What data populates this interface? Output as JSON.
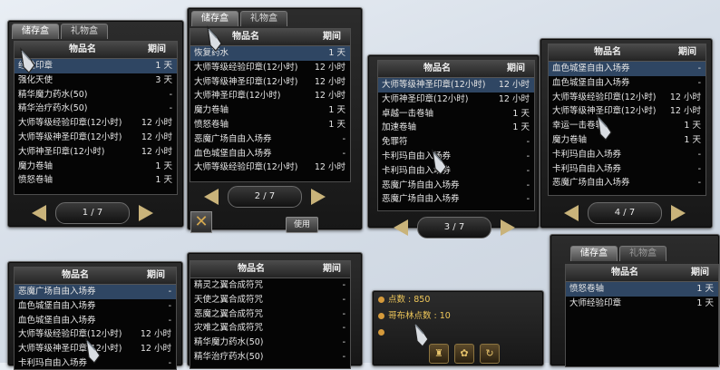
{
  "panels": [
    {
      "tabs": [
        "储存盒",
        "礼物盒"
      ],
      "header": {
        "name": "物品名",
        "period": "期间"
      },
      "page": "1 / 7",
      "items": [
        [
          "经验印章",
          "1 天"
        ],
        [
          "强化天使",
          "3 天"
        ],
        [
          "精华魔力药水(50)",
          "-"
        ],
        [
          "精华治疗药水(50)",
          "-"
        ],
        [
          "大师等级经验印章(12小时)",
          "12 小时"
        ],
        [
          "大师等级神圣印章(12小时)",
          "12 小时"
        ],
        [
          "大师神圣印章(12小时)",
          "12 小时"
        ],
        [
          "魔力卷轴",
          "1 天"
        ],
        [
          "愤怒卷轴",
          "1 天"
        ]
      ]
    },
    {
      "tabs": [
        "储存盒",
        "礼物盒"
      ],
      "header": {
        "name": "物品名",
        "period": "期间"
      },
      "page": "2 / 7",
      "use_button": "使用",
      "items": [
        [
          "恢复药水",
          "1 天"
        ],
        [
          "大师等级经验印章(12小时)",
          "12 小时"
        ],
        [
          "大师等级神圣印章(12小时)",
          "12 小时"
        ],
        [
          "大师神圣印章(12小时)",
          "12 小时"
        ],
        [
          "魔力卷轴",
          "1 天"
        ],
        [
          "愤怒卷轴",
          "1 天"
        ],
        [
          "恶魔广场自由入场券",
          "-"
        ],
        [
          "血色城堡自由入场券",
          "-"
        ],
        [
          "大师等级经验印章(12小时)",
          "12 小时"
        ]
      ]
    },
    {
      "header": {
        "name": "物品名",
        "period": "期间"
      },
      "page": "3 / 7",
      "items": [
        [
          "大师等级神圣印章(12小时)",
          "12 小时"
        ],
        [
          "大师神圣印章(12小时)",
          "12 小时"
        ],
        [
          "卓越一击卷轴",
          "1 天"
        ],
        [
          "加速卷轴",
          "1 天"
        ],
        [
          "免罪符",
          "-"
        ],
        [
          "卡利玛自由入场券",
          "-"
        ],
        [
          "卡利玛自由入场券",
          "-"
        ],
        [
          "恶魔广场自由入场券",
          "-"
        ],
        [
          "恶魔广场自由入场券",
          "-"
        ]
      ]
    },
    {
      "header": {
        "name": "物品名",
        "period": "期间"
      },
      "page": "4 / 7",
      "items": [
        [
          "血色城堡自由入场券",
          "-"
        ],
        [
          "血色城堡自由入场券",
          "-"
        ],
        [
          "大师等级经验印章(12小时)",
          "12 小时"
        ],
        [
          "大师等级神圣印章(12小时)",
          "12 小时"
        ],
        [
          "幸运一击卷轴",
          "1 天"
        ],
        [
          "魔力卷轴",
          "1 天"
        ],
        [
          "卡利玛自由入场券",
          "-"
        ],
        [
          "卡利玛自由入场券",
          "-"
        ],
        [
          "恶魔广场自由入场券",
          "-"
        ]
      ]
    },
    {
      "header": {
        "name": "物品名",
        "period": "期间"
      },
      "items": [
        [
          "恶魔广场自由入场券",
          "-"
        ],
        [
          "血色城堡自由入场券",
          "-"
        ],
        [
          "血色城堡自由入场券",
          "-"
        ],
        [
          "大师等级经验印章(12小时)",
          "12 小时"
        ],
        [
          "大师等级神圣印章(12小时)",
          "12 小时"
        ],
        [
          "卡利玛自由入场券",
          "-"
        ]
      ]
    },
    {
      "header": {
        "name": "物品名",
        "period": "期间"
      },
      "items": [
        [
          "精灵之翼合成符咒",
          "-"
        ],
        [
          "天使之翼合成符咒",
          "-"
        ],
        [
          "恶魔之翼合成符咒",
          "-"
        ],
        [
          "灾难之翼合成符咒",
          "-"
        ],
        [
          "精华魔力药水(50)",
          "-"
        ],
        [
          "精华治疗药水(50)",
          "-"
        ]
      ]
    },
    {
      "tabs": [
        "储存盒",
        "礼物盒"
      ],
      "header": {
        "name": "物品名",
        "period": "期间"
      },
      "items": [
        [
          "愤怒卷轴",
          "1 天"
        ],
        [
          "大师经验印章",
          "1 天"
        ]
      ]
    }
  ],
  "points": {
    "label1": "点数 : 850",
    "label2": "哥布林点数 : 10"
  },
  "icons": {
    "cursor": "gauntlet-cursor-icon",
    "prev": "arrow-left-icon",
    "next": "arrow-right-icon",
    "close": "close-x-icon"
  },
  "colors": {
    "gold": "#c9b37a",
    "selected_row": "#2f4663"
  }
}
